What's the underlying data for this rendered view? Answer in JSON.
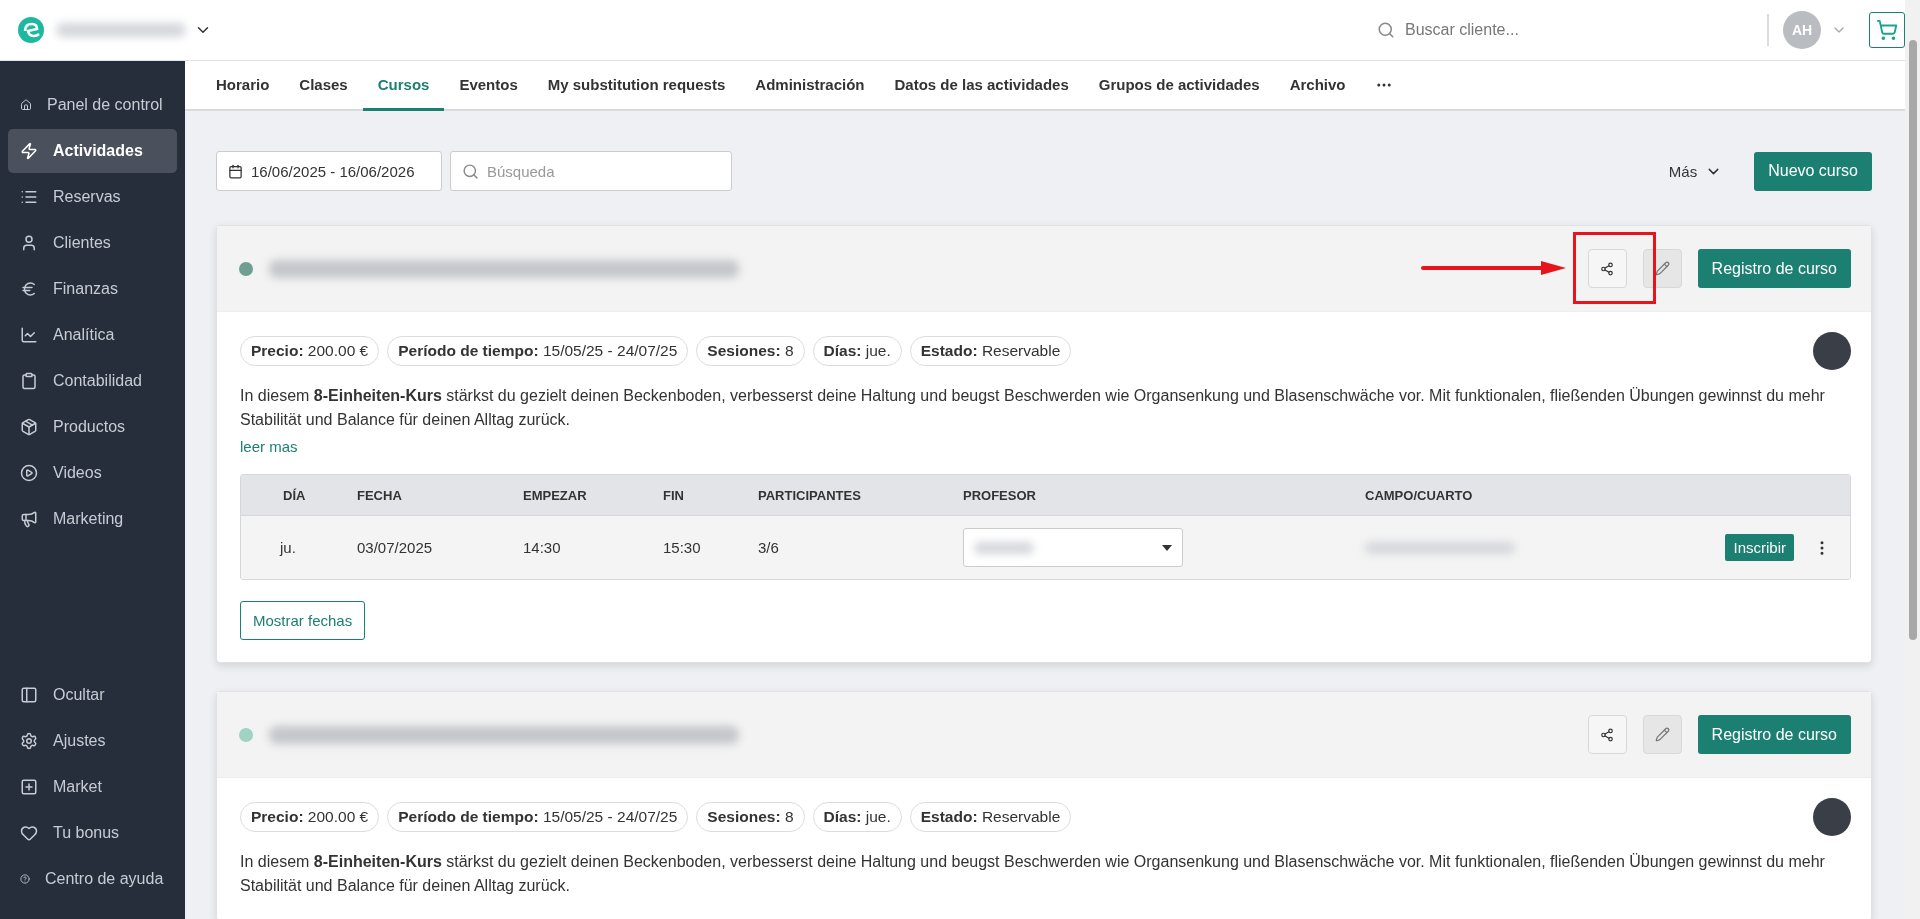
{
  "header": {
    "search_placeholder": "Buscar cliente...",
    "avatar_initials": "AH"
  },
  "sidebar": {
    "items": [
      {
        "label": "Panel de control",
        "selected": false
      },
      {
        "label": "Actividades",
        "selected": true
      },
      {
        "label": "Reservas",
        "selected": false
      },
      {
        "label": "Clientes",
        "selected": false
      },
      {
        "label": "Finanzas",
        "selected": false
      },
      {
        "label": "Analítica",
        "selected": false
      },
      {
        "label": "Contabilidad",
        "selected": false
      },
      {
        "label": "Productos",
        "selected": false
      },
      {
        "label": "Videos",
        "selected": false
      },
      {
        "label": "Marketing",
        "selected": false
      }
    ],
    "bottom_items": [
      {
        "label": "Ocultar"
      },
      {
        "label": "Ajustes"
      },
      {
        "label": "Market"
      },
      {
        "label": "Tu bonus"
      },
      {
        "label": "Centro de ayuda"
      }
    ]
  },
  "tabs": [
    {
      "label": "Horario",
      "selected": false
    },
    {
      "label": "Clases",
      "selected": false
    },
    {
      "label": "Cursos",
      "selected": true
    },
    {
      "label": "Eventos",
      "selected": false
    },
    {
      "label": "My substitution requests",
      "selected": false
    },
    {
      "label": "Administración",
      "selected": false
    },
    {
      "label": "Datos de las actividades",
      "selected": false
    },
    {
      "label": "Grupos de actividades",
      "selected": false
    },
    {
      "label": "Archivo",
      "selected": false
    }
  ],
  "toolbar": {
    "date_range": "16/06/2025 - 16/06/2026",
    "search_placeholder": "Búsqueda",
    "more": "Más",
    "new_course": "Nuevo curso"
  },
  "courses": [
    {
      "color": "#6f9e92",
      "share_highlighted": true,
      "register": "Registro de curso",
      "tags": [
        "**Precio:** 200.00 €",
        "**Período de tiempo:** 15/05/25 - 24/07/25",
        "**Sesiones:** 8",
        "**Días:** jue.",
        "**Estado:** Reservable"
      ],
      "description": "In diesem **8-Einheiten-Kurs** stärkst du gezielt deinen Beckenboden, verbesserst deine Haltung und beugst Beschwerden wie Organsenkung und Blasenschwäche vor. Mit funktionalen, fließenden Übungen gewinnst du mehr Stabilität und Balance für deinen Alltag zurück.",
      "read_more": "leer mas",
      "table": {
        "columns": [
          "DÍA",
          "FECHA",
          "EMPEZAR",
          "FIN",
          "PARTICIPANTES",
          "PROFESOR",
          "CAMPO/CUARTO"
        ],
        "rows": [
          {
            "day": "ju.",
            "date": "03/07/2025",
            "start": "14:30",
            "end": "15:30",
            "participants": "3/6",
            "enroll": "Inscribir"
          }
        ]
      },
      "show_dates": "Mostrar fechas"
    },
    {
      "color": "#9fd3c4",
      "share_highlighted": false,
      "register": "Registro de curso",
      "tags": [
        "**Precio:** 200.00 €",
        "**Período de tiempo:** 15/05/25 - 24/07/25",
        "**Sesiones:** 8",
        "**Días:** jue.",
        "**Estado:** Reservable"
      ],
      "description": "In diesem **8-Einheiten-Kurs** stärkst du gezielt deinen Beckenboden, verbesserst deine Haltung und beugst Beschwerden wie Organsenkung und Blasenschwäche vor. Mit funktionalen, fließenden Übungen gewinnst du mehr Stabilität und Balance für deinen Alltag zurück."
    }
  ]
}
